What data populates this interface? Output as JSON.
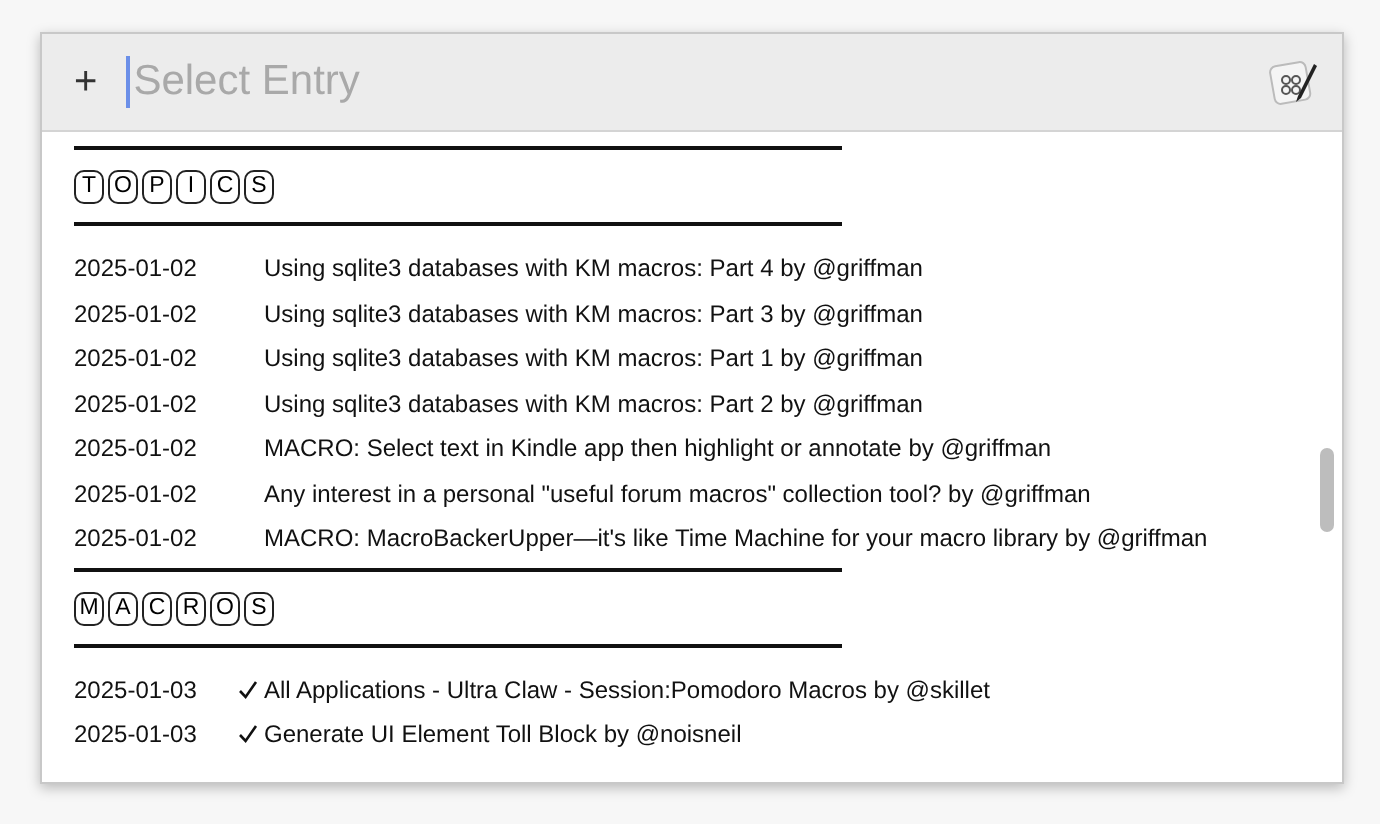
{
  "search": {
    "button": "+",
    "placeholder": "Select Entry"
  },
  "sections": [
    {
      "letters": [
        "T",
        "O",
        "P",
        "I",
        "C",
        "S"
      ],
      "entries": [
        {
          "date": "2025-01-02",
          "text": "Using sqlite3 databases with KM macros: Part 4 by @griffman",
          "checked": false
        },
        {
          "date": "2025-01-02",
          "text": "Using sqlite3 databases with KM macros: Part 3 by @griffman",
          "checked": false
        },
        {
          "date": "2025-01-02",
          "text": "Using sqlite3 databases with KM macros: Part 1 by @griffman",
          "checked": false
        },
        {
          "date": "2025-01-02",
          "text": "Using sqlite3 databases with KM macros: Part 2 by @griffman",
          "checked": false
        },
        {
          "date": "2025-01-02",
          "text": "MACRO: Select text in Kindle app then highlight or annotate by @griffman",
          "checked": false
        },
        {
          "date": "2025-01-02",
          "text": "Any interest in a personal \"useful forum macros\" collection tool? by @griffman",
          "checked": false
        },
        {
          "date": "2025-01-02",
          "text": "MACRO: MacroBackerUpper—it's like Time Machine for your macro library by @griffman",
          "checked": false
        }
      ]
    },
    {
      "letters": [
        "M",
        "A",
        "C",
        "R",
        "O",
        "S"
      ],
      "entries": [
        {
          "date": "2025-01-03",
          "text": "All Applications - Ultra Claw - Session:Pomodoro Macros by @skillet",
          "checked": true
        },
        {
          "date": "2025-01-03",
          "text": "Generate UI Element Toll Block by @noisneil",
          "checked": true
        }
      ]
    }
  ]
}
